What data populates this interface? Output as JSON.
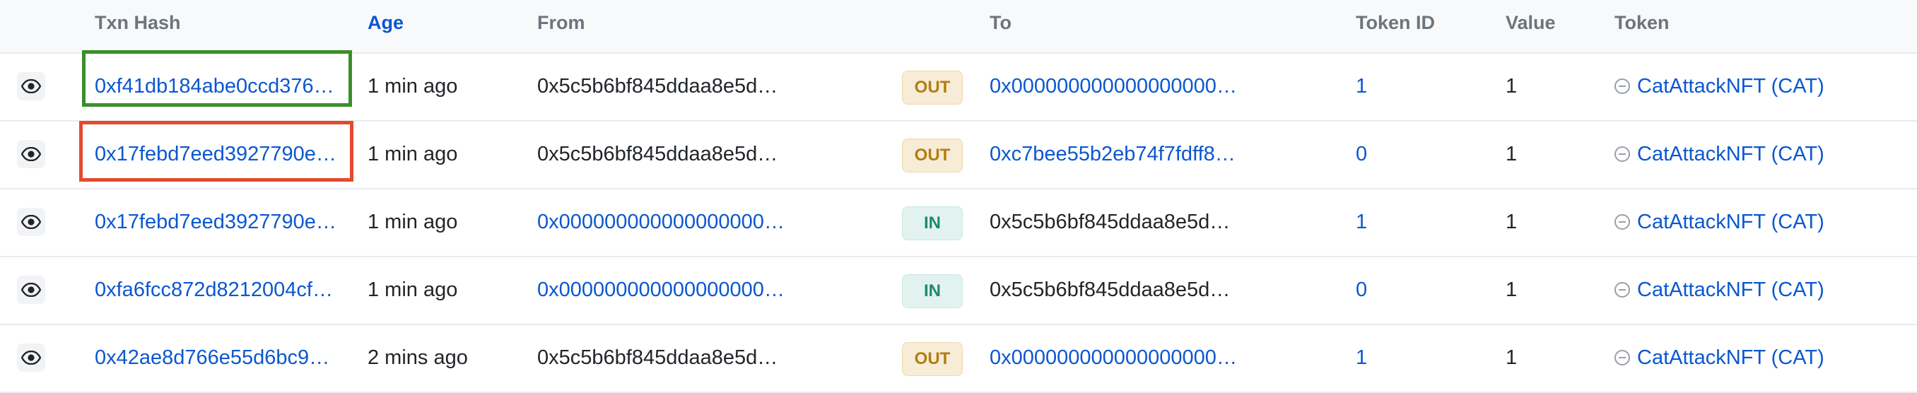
{
  "columns": {
    "txn_hash": "Txn Hash",
    "age": "Age",
    "from": "From",
    "to": "To",
    "token_id": "Token ID",
    "value": "Value",
    "token": "Token"
  },
  "rows": [
    {
      "hash": "0xf41db184abe0ccd376…",
      "age": "1 min ago",
      "from": "0x5c5b6bf845ddaa8e5d…",
      "direction": "OUT",
      "to": "0x000000000000000000…",
      "token_id": "1",
      "value": "1",
      "token": "CatAttackNFT (CAT)"
    },
    {
      "hash": "0x17febd7eed3927790e…",
      "age": "1 min ago",
      "from": "0x5c5b6bf845ddaa8e5d…",
      "direction": "OUT",
      "to": "0xc7bee55b2eb74f7fdff8…",
      "token_id": "0",
      "value": "1",
      "token": "CatAttackNFT (CAT)"
    },
    {
      "hash": "0x17febd7eed3927790e…",
      "age": "1 min ago",
      "from": "0x000000000000000000…",
      "direction": "IN",
      "to": "0x5c5b6bf845ddaa8e5d…",
      "token_id": "1",
      "value": "1",
      "token": "CatAttackNFT (CAT)"
    },
    {
      "hash": "0xfa6fcc872d8212004cf4…",
      "age": "1 min ago",
      "from": "0x000000000000000000…",
      "direction": "IN",
      "to": "0x5c5b6bf845ddaa8e5d…",
      "token_id": "0",
      "value": "1",
      "token": "CatAttackNFT (CAT)"
    },
    {
      "hash": "0x42ae8d766e55d6bc94…",
      "age": "2 mins ago",
      "from": "0x5c5b6bf845ddaa8e5d…",
      "direction": "OUT",
      "to": "0x000000000000000000…",
      "token_id": "1",
      "value": "1",
      "token": "CatAttackNFT (CAT)"
    }
  ],
  "colors": {
    "link": "#0b57d0",
    "out_badge": "#b47d12",
    "in_badge": "#1e8a68",
    "highlight_green": "#3a8f2a",
    "highlight_red": "#e34a2f"
  },
  "icons": {
    "view": "eye-icon",
    "token": "token-icon"
  }
}
